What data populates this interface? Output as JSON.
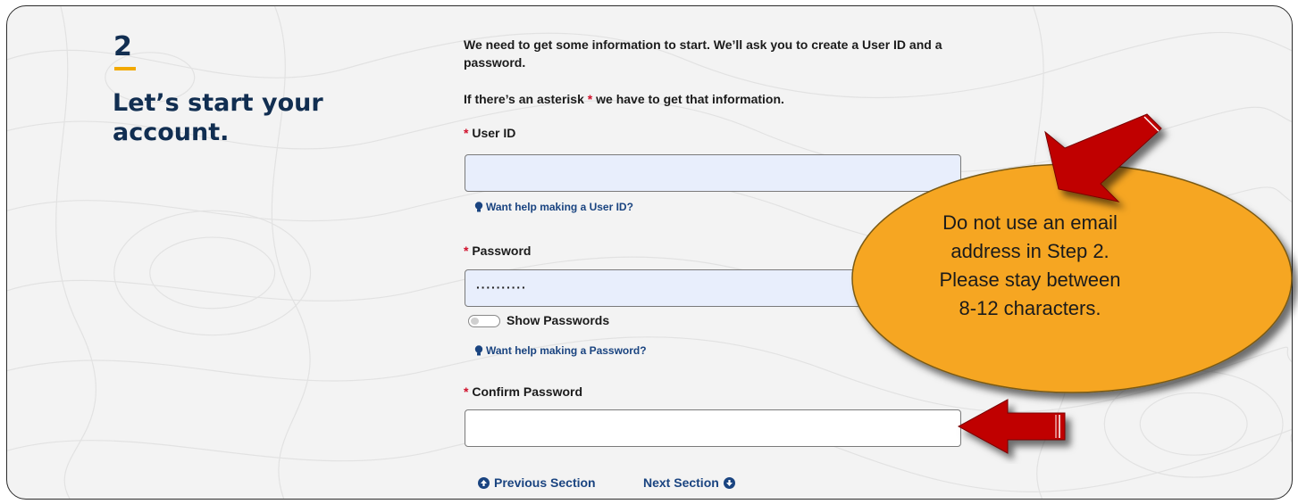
{
  "step": {
    "number": "2",
    "headline": "Let’s start your account."
  },
  "form": {
    "intro": "We need to get some information to start. We’ll ask you to create a User ID and a password.",
    "asterisk_note_before": "If there’s an asterisk ",
    "asterisk": "*",
    "asterisk_note_after": " we have to get that information.",
    "user_id": {
      "label": "User ID",
      "value": "",
      "help_link": "Want help making a User ID?"
    },
    "password": {
      "label": "Password",
      "value": "··········",
      "help_link": "Want help making a Password?"
    },
    "show_passwords": {
      "label": "Show Passwords",
      "checked": false
    },
    "confirm_password": {
      "label": "Confirm Password",
      "value": ""
    }
  },
  "navigation": {
    "previous": "Previous Section",
    "next": "Next Section"
  },
  "callout": {
    "text_lines": [
      "Do not use an email",
      "address in Step 2.",
      "Please stay between",
      "8-12 characters."
    ]
  },
  "colors": {
    "heading_navy": "#112e51",
    "accent_gold": "#f2a900",
    "required_red": "#d0102b",
    "link_blue": "#1a4480",
    "callout_fill": "#f6a623",
    "arrow_red": "#c00000",
    "input_fill": "#e8eefc"
  },
  "icons": [
    "asterisk",
    "lightbulb-icon",
    "arrow-up-circle-icon",
    "arrow-down-circle-icon",
    "toggle-switch",
    "red-arrow-pointer"
  ]
}
